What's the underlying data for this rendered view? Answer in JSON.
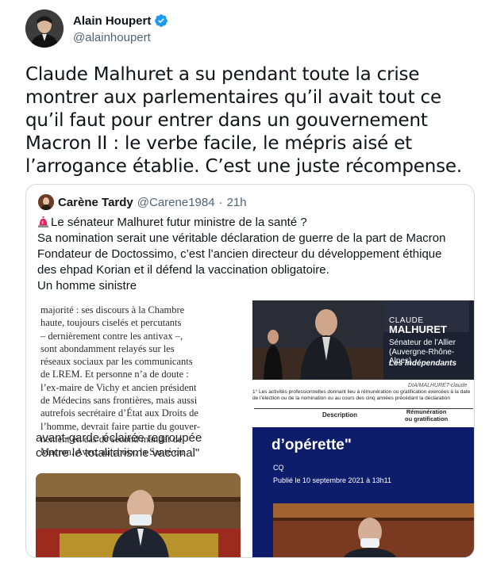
{
  "tweet": {
    "author_name": "Alain Houpert",
    "author_handle": "@alainhoupert",
    "text": "Claude Malhuret a su pendant toute la crise montrer aux parlementaires qu’il avait tout ce qu’il faut pour entrer dans un gouvernement Macron II : le verbe facile, le mépris aisé et l’arrogance établie. C’est une juste récompense.",
    "verified_icon": "verified-badge-icon",
    "accent_color": "#1d9bf0"
  },
  "quoted": {
    "author_name": "Carène Tardy",
    "author_handle": "@Carene1984",
    "separator": "·",
    "time": "21h",
    "lines": [
      "Le sénateur Malhuret futur ministre de la santé ?",
      "Sa nomination serait une véritable déclaration de guerre de la part de Macron",
      "Fondateur de Doctossimo, c’est l’ancien directeur du développement éthique",
      "des ehpad Korian et il défend la vaccination obligatoire.",
      "Un homme sinistre"
    ],
    "siren_icon": "police-light-icon",
    "media_left": {
      "clip_lines": [
        "majorité : ses discours à la Chambre",
        "haute, toujours ciselés et percutants",
        "– dernièrement contre les antivax –,",
        "sont abondamment relayés sur les",
        "réseaux sociaux par les communicants",
        "de LREM. Et personne n’a de doute :",
        "l’ex-maire de Vichy et ancien président",
        "de Médecins sans frontières, mais aussi",
        "autrefois secrétaire d’État aux Droits de",
        "l’homme, devrait faire partie du gouver-",
        "nement en cas de second mandat de",
        "Macron. Avec, au choix, la Santé ou"
      ],
      "big_lines": [
        "avant-garde éclairée regroupée",
        "contre le totalitarisme vaccinal\""
      ]
    },
    "media_right": {
      "tv_first_name": "CLAUDE",
      "tv_last_name": "MALHURET",
      "tv_sub1": "Sénateur de l’Allier",
      "tv_sub2": "(Auvergne-Rhône-Alpes)",
      "tv_group": "Les Indépendants",
      "photo_credit": "DIA/MALHURET-claude",
      "doc_header": "1° Les activités professionnelles donnant lieu à rémunération ou gratification exercées à la date de l’élection ou de la nomination ou au cours des cinq années précédant la déclaration",
      "col_description": "Description",
      "col_remuneration_1": "Rémunération",
      "col_remuneration_2": "ou gratification",
      "blue_title": "d’opérette\"",
      "blue_author": "CQ",
      "blue_date": "Publié le 10 septembre 2021 à 13h11"
    }
  }
}
